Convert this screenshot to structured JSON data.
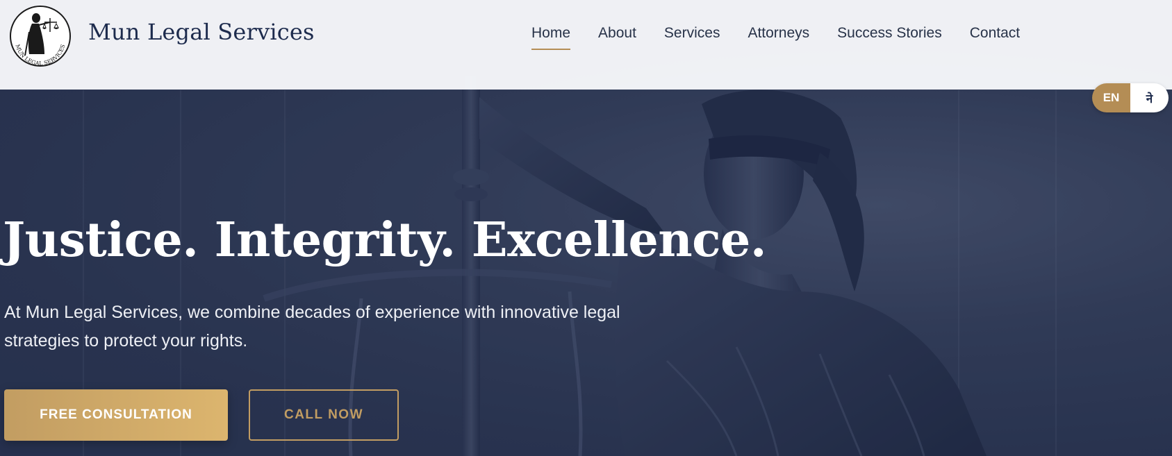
{
  "brand": {
    "name": "Mun Legal Services",
    "logo_ring_text": "MUN LEGAL SERVICES"
  },
  "nav": {
    "items": [
      {
        "label": "Home",
        "active": true
      },
      {
        "label": "About",
        "active": false
      },
      {
        "label": "Services",
        "active": false
      },
      {
        "label": "Attorneys",
        "active": false
      },
      {
        "label": "Success Stories",
        "active": false
      },
      {
        "label": "Contact",
        "active": false
      }
    ]
  },
  "language_toggle": {
    "options": [
      "EN",
      "ने"
    ],
    "selected": "EN"
  },
  "hero": {
    "title": "Justice. Integrity. Excellence.",
    "subtitle": "At Mun Legal Services, we combine decades of experience with innovative legal strategies to protect your rights.",
    "primary_cta": "FREE CONSULTATION",
    "secondary_cta": "CALL NOW"
  },
  "colors": {
    "accent_gold": "#b48d55",
    "navy": "#1d2b4d",
    "hero_overlay": "#2f3a57"
  },
  "icons": {
    "logo": "lady-justice-icon"
  }
}
